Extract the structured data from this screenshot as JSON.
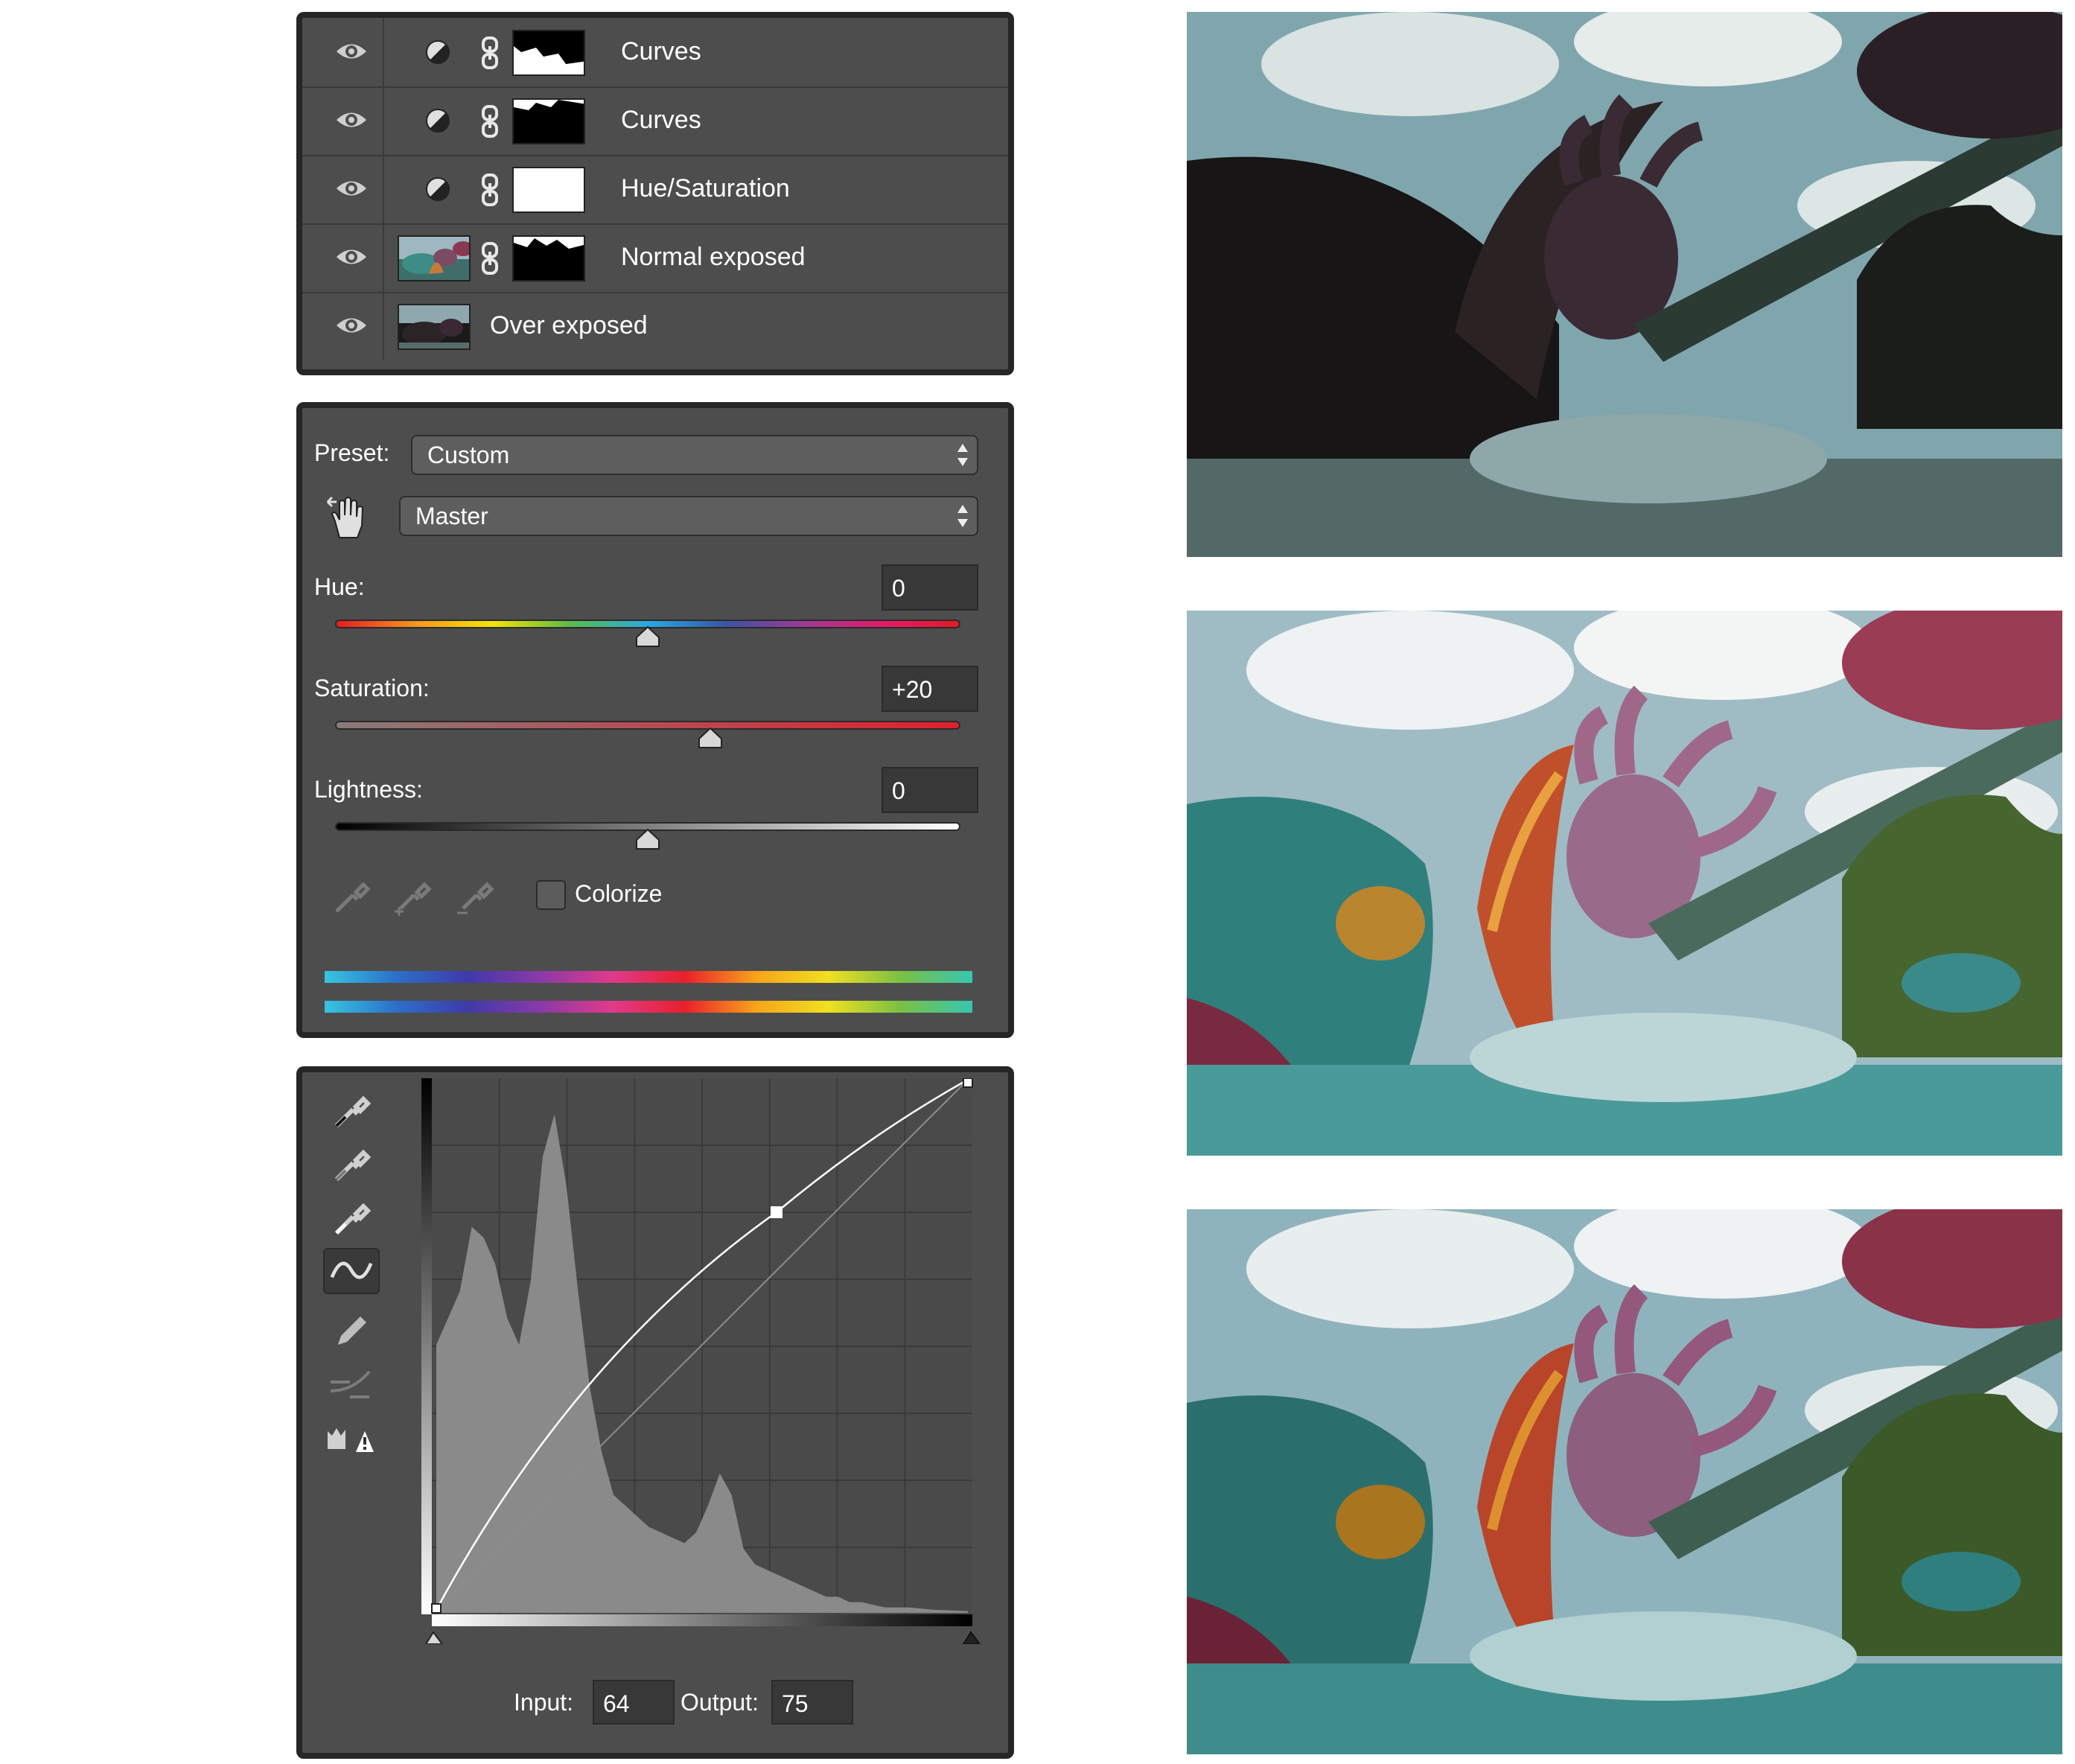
{
  "layers_panel": {
    "rows": [
      {
        "name": "Curves",
        "type": "adjustment"
      },
      {
        "name": "Curves",
        "type": "adjustment"
      },
      {
        "name": "Hue/Saturation",
        "type": "adjustment"
      },
      {
        "name": "Normal exposed",
        "type": "image-with-mask"
      },
      {
        "name": "Over exposed",
        "type": "image"
      }
    ]
  },
  "hue_saturation": {
    "preset_label": "Preset:",
    "preset_value": "Custom",
    "channel_value": "Master",
    "hue": {
      "label": "Hue:",
      "value": "0",
      "level": 0.5
    },
    "saturation": {
      "label": "Saturation:",
      "value": "+20",
      "level": 0.6
    },
    "lightness": {
      "label": "Lightness:",
      "value": "0",
      "level": 0.5
    },
    "colorize_label": "Colorize",
    "colorize_checked": false
  },
  "curves": {
    "input_label": "Input:",
    "input_value": "64",
    "output_label": "Output:",
    "output_value": "75",
    "tools": [
      "eyedropper-black-icon",
      "eyedropper-gray-icon",
      "eyedropper-white-icon",
      "curve-point-icon",
      "pencil-icon",
      "smooth-icon",
      "clipping-warning-icon"
    ],
    "active_tool": "curve-point-icon"
  },
  "photos": [
    {
      "label": "dark-exposure"
    },
    {
      "label": "normal-exposure"
    },
    {
      "label": "final-composite"
    }
  ]
}
